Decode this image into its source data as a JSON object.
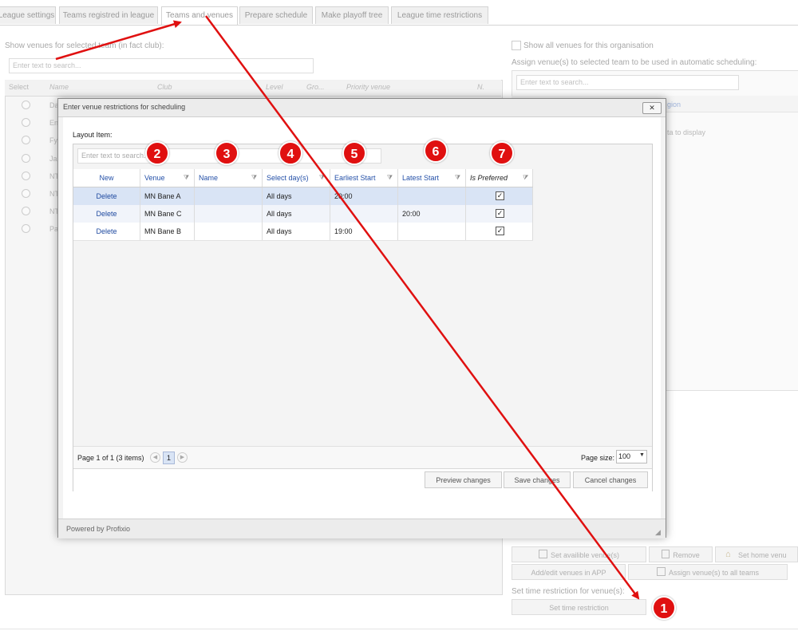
{
  "tabs": [
    "League settings",
    "Teams registred in league",
    "Teams and venues",
    "Prepare schedule",
    "Make playoff tree",
    "League time restrictions"
  ],
  "left": {
    "label": "Show venues for selected team (in fact club):",
    "search_placeholder": "Enter text to search...",
    "columns": [
      "Select",
      "Name",
      "Club",
      "Level",
      "Gro...",
      "Priority venue",
      "N."
    ],
    "rows": [
      "Da",
      "En",
      "Fy",
      "Ja",
      "NT",
      "NT",
      "NT",
      "Pa"
    ]
  },
  "right": {
    "show_all_label": "Show all venues for this organisation",
    "assign_label": "Assign venue(s) to selected team to be used in automatic scheduling:",
    "search_placeholder": "Enter text to search...",
    "region_text": "gion",
    "no_data_text": "ta to display",
    "buttons": {
      "set_available": "Set availible venue(s)",
      "remove": "Remove",
      "set_home": "Set home venu",
      "add_edit": "Add/edit venues in APP",
      "assign_all": "Assign venue(s) to all teams"
    },
    "time_label": "Set time restriction for venue(s):",
    "time_button": "Set time restriction"
  },
  "modal": {
    "title": "Enter venue restrictions for scheduling",
    "close": "✕",
    "layout_item": "Layout Item:",
    "search_placeholder": "Enter text to search...",
    "columns": {
      "new": "New",
      "venue": "Venue",
      "name": "Name",
      "days": "Select day(s)",
      "earliest": "Earliest Start",
      "latest": "Latest Start",
      "preferred": "Is Preferred"
    },
    "rows": [
      {
        "action": "Delete",
        "venue": "MN Bane A",
        "name": "",
        "days": "All days",
        "earliest": "20:00",
        "latest": "",
        "preferred": true
      },
      {
        "action": "Delete",
        "venue": "MN Bane C",
        "name": "",
        "days": "All days",
        "earliest": "",
        "latest": "20:00",
        "preferred": true
      },
      {
        "action": "Delete",
        "venue": "MN Bane B",
        "name": "",
        "days": "All days",
        "earliest": "19:00",
        "latest": "",
        "preferred": true
      }
    ],
    "pager": {
      "summary": "Page 1 of 1 (3 items)",
      "current_page": "1",
      "page_size_label": "Page size:",
      "page_size": "100"
    },
    "buttons": {
      "preview": "Preview changes",
      "save": "Save changes",
      "cancel": "Cancel changes"
    },
    "footer": "Powered by Profixio"
  },
  "badges": [
    "1",
    "2",
    "3",
    "4",
    "5",
    "6",
    "7"
  ],
  "accent_color": "#e01010"
}
